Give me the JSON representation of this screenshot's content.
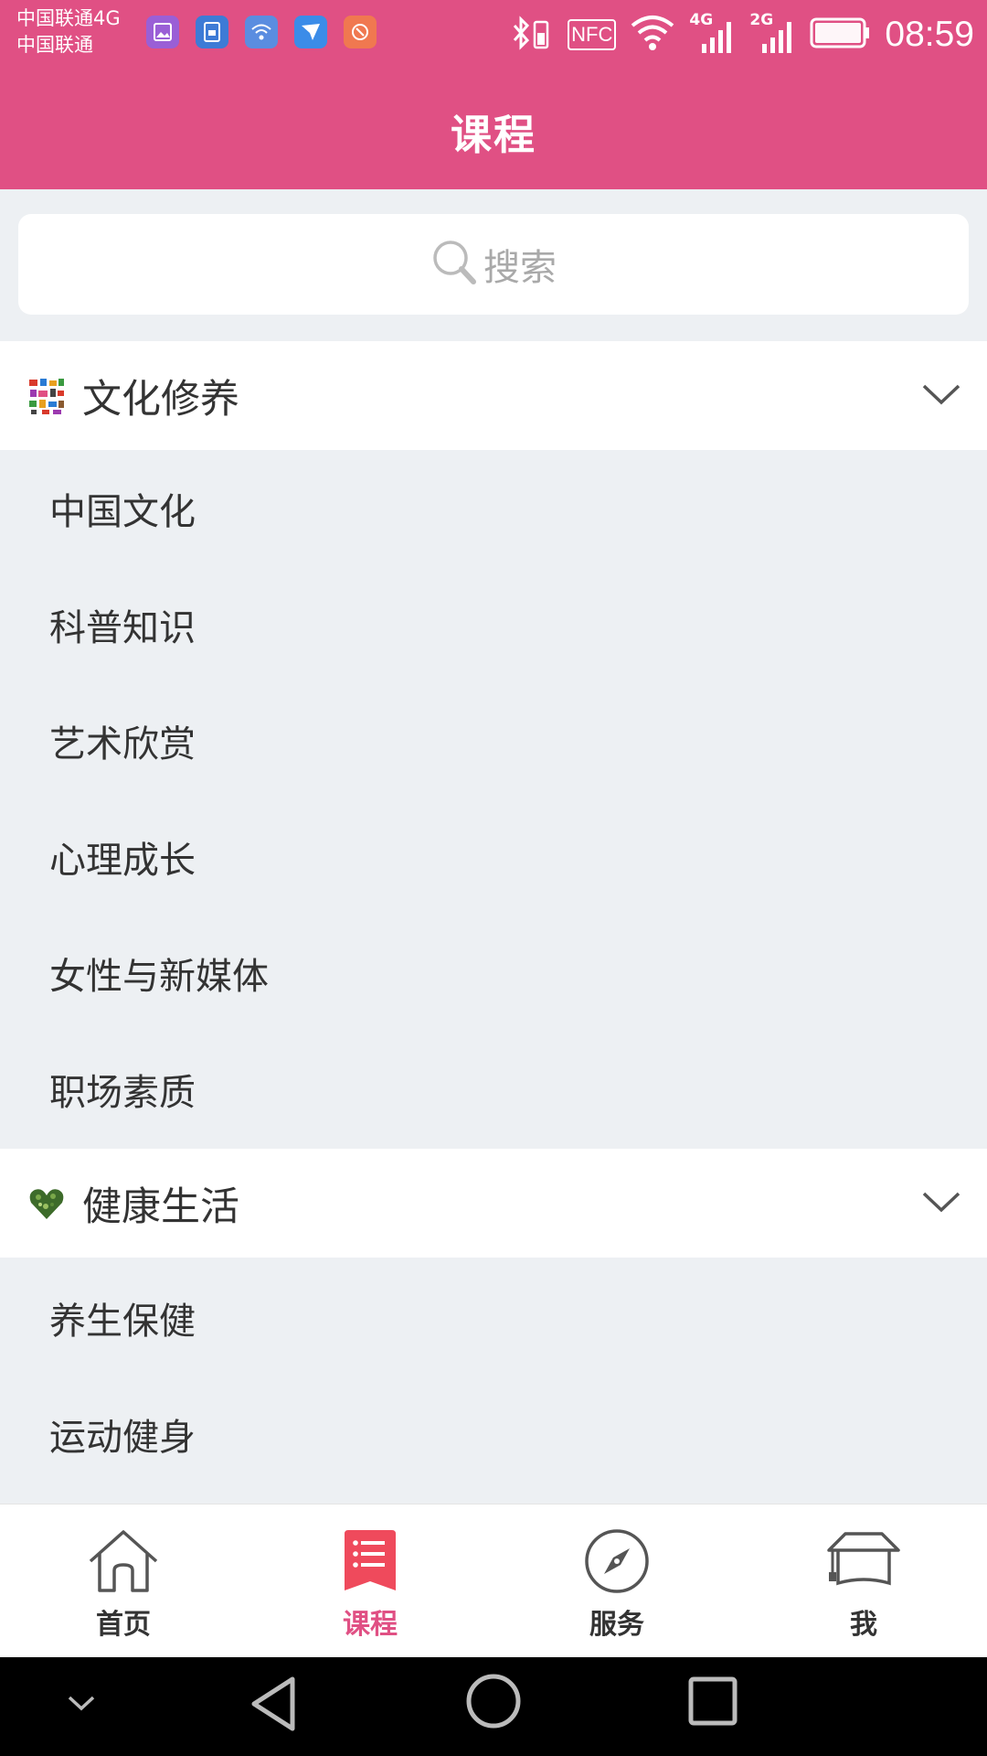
{
  "status": {
    "carrier_line1": "中国联通4G",
    "carrier_line2": "中国联通",
    "time": "08:59",
    "nfc": "NFC",
    "net_4g": "4G",
    "net_2g": "2G"
  },
  "header": {
    "title": "课程"
  },
  "search": {
    "placeholder": "搜索"
  },
  "sections": [
    {
      "title": "文化修养",
      "items": [
        "中国文化",
        "科普知识",
        "艺术欣赏",
        "心理成长",
        "女性与新媒体",
        "职场素质"
      ]
    },
    {
      "title": "健康生活",
      "items": [
        "养生保健",
        "运动健身"
      ]
    }
  ],
  "tabs": [
    {
      "label": "首页",
      "icon": "home-icon"
    },
    {
      "label": "课程",
      "icon": "course-list-icon",
      "active": true
    },
    {
      "label": "服务",
      "icon": "compass-icon"
    },
    {
      "label": "我",
      "icon": "graduation-cap-icon"
    }
  ],
  "colors": {
    "accent": "#e05084",
    "background": "#edf0f3",
    "text": "#333333",
    "placeholder": "#a9a9a9"
  }
}
